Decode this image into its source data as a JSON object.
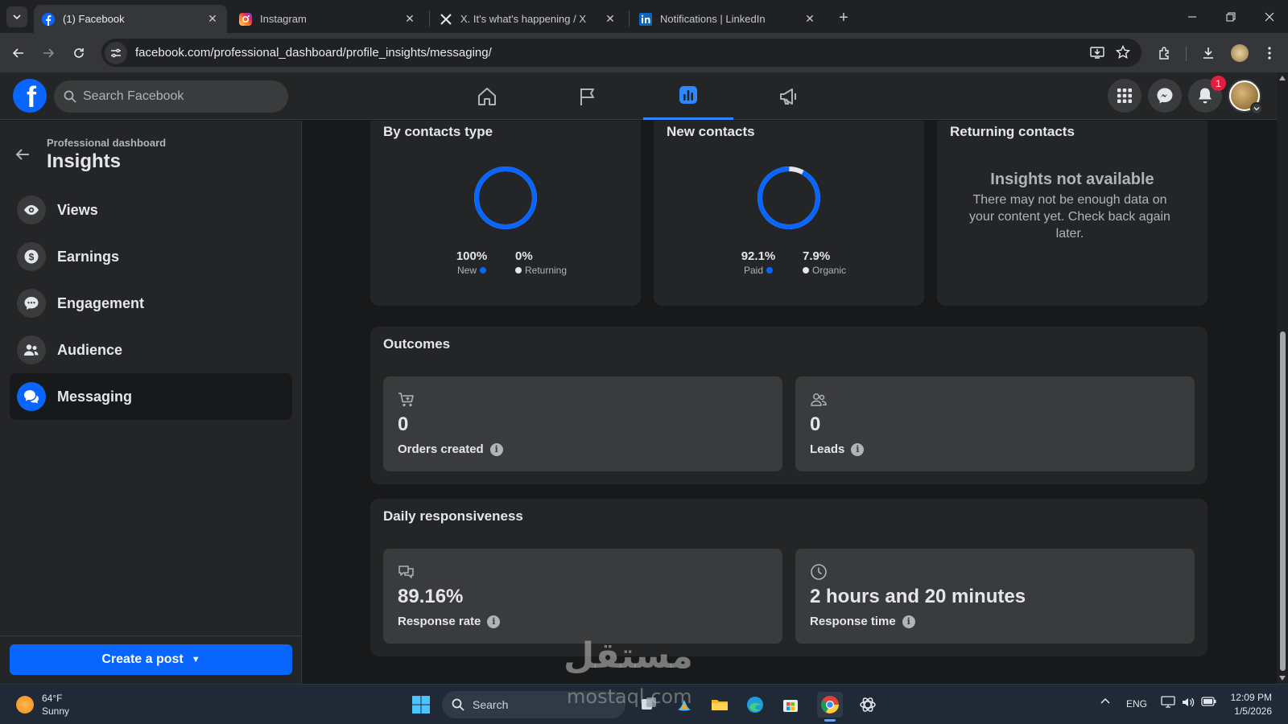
{
  "browser": {
    "tabs": [
      {
        "title": "(1) Facebook",
        "active": true,
        "favicon": "facebook-icon"
      },
      {
        "title": "Instagram",
        "active": false,
        "favicon": "instagram-icon"
      },
      {
        "title": "X. It's what's happening / X",
        "active": false,
        "favicon": "x-icon"
      },
      {
        "title": "Notifications | LinkedIn",
        "active": false,
        "favicon": "linkedin-icon"
      }
    ],
    "url": "facebook.com/professional_dashboard/profile_insights/messaging/"
  },
  "facebook": {
    "search_placeholder": "Search Facebook",
    "notification_count": "1",
    "accent": "#0866ff"
  },
  "sidebar": {
    "subtitle": "Professional dashboard",
    "title": "Insights",
    "items": [
      {
        "label": "Views",
        "icon": "eye-icon"
      },
      {
        "label": "Earnings",
        "icon": "dollar-icon"
      },
      {
        "label": "Engagement",
        "icon": "chat-bubble-icon"
      },
      {
        "label": "Audience",
        "icon": "people-icon"
      },
      {
        "label": "Messaging",
        "icon": "messaging-icon",
        "active": true
      }
    ],
    "create_post": "Create a post"
  },
  "contacts": {
    "by_type": {
      "title": "By contacts type",
      "left_pct": "100%",
      "left_label": "New",
      "right_pct": "0%",
      "right_label": "Returning",
      "fraction_primary": 1.0
    },
    "new_contacts": {
      "title": "New contacts",
      "left_pct": "92.1%",
      "left_label": "Paid",
      "right_pct": "7.9%",
      "right_label": "Organic",
      "fraction_primary": 0.921
    },
    "returning": {
      "title": "Returning contacts",
      "na_title": "Insights not available",
      "na_text": "There may not be enough data on your content yet. Check back again later."
    },
    "primary_color": "#0866ff",
    "secondary_color": "#e4e6eb"
  },
  "outcomes": {
    "title": "Outcomes",
    "orders": {
      "value": "0",
      "label": "Orders created",
      "icon": "cart-icon"
    },
    "leads": {
      "value": "0",
      "label": "Leads",
      "icon": "people-outline-icon"
    }
  },
  "responsiveness": {
    "title": "Daily responsiveness",
    "rate": {
      "value": "89.16%",
      "label": "Response rate",
      "icon": "chat-outline-icon"
    },
    "time": {
      "value": "2 hours and 20 minutes",
      "label": "Response time",
      "icon": "clock-icon"
    }
  },
  "taskbar": {
    "temp": "64°F",
    "condition": "Sunny",
    "search": "Search",
    "lang": "ENG",
    "time": "12:09 PM",
    "date": "1/5/2026"
  },
  "watermark": {
    "arabic": "مستقل",
    "latin": "mostaql.com"
  }
}
